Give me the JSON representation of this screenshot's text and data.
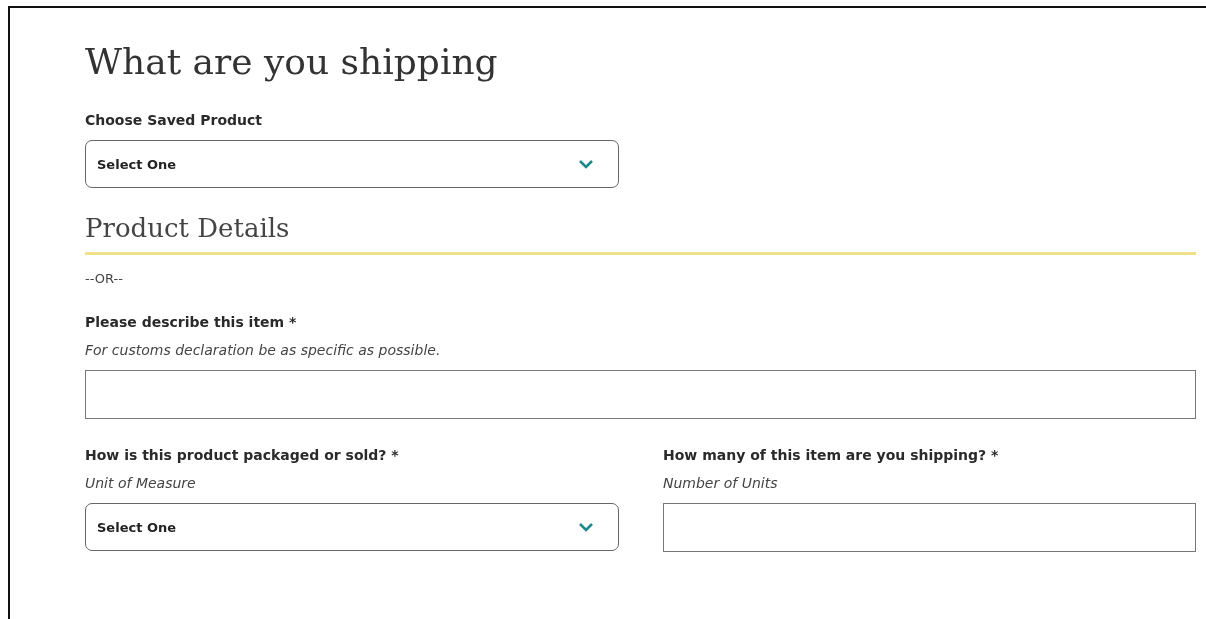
{
  "title": "What are you shipping",
  "saved_product": {
    "label": "Choose Saved Product",
    "value": "Select One"
  },
  "section": {
    "title": "Product Details"
  },
  "separator": "--OR--",
  "description": {
    "label": "Please describe this item *",
    "hint": "For customs declaration be as specific as possible."
  },
  "packaging": {
    "label": "How is this product packaged or sold? *",
    "hint": "Unit of Measure",
    "value": "Select One"
  },
  "quantity": {
    "label": "How many of this item are you shipping? *",
    "hint": "Number of Units"
  }
}
